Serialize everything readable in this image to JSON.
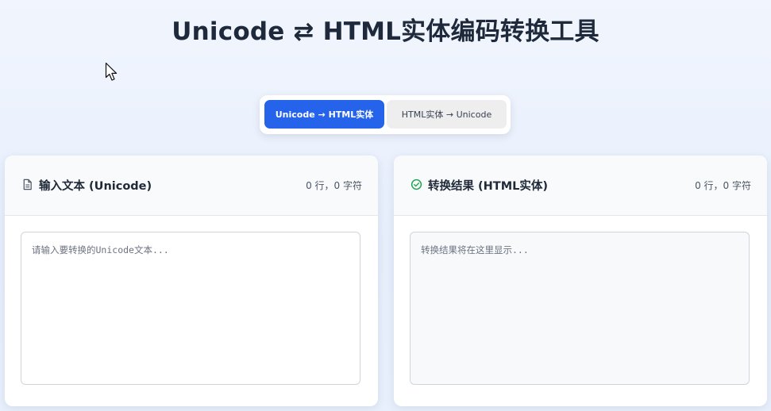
{
  "app": {
    "title": "Unicode ⇄ HTML实体编码转换工具"
  },
  "mode_tabs": [
    {
      "label": "Unicode → HTML实体",
      "active": true
    },
    {
      "label": "HTML实体 → Unicode",
      "active": false
    }
  ],
  "input_panel": {
    "icon": "document-icon",
    "title": "输入文本 (Unicode)",
    "count": "0 行，0 字符",
    "value": "",
    "placeholder": "请输入要转换的Unicode文本..."
  },
  "output_panel": {
    "icon": "check-circle-icon",
    "title": "转换结果 (HTML实体)",
    "count": "0 行，0 字符",
    "value": "",
    "placeholder": "转换结果将在这里显示..."
  },
  "colors": {
    "accent": "#2563eb",
    "success": "#16a34a",
    "title_text": "#1e293b",
    "background": "#eaf0fd"
  }
}
